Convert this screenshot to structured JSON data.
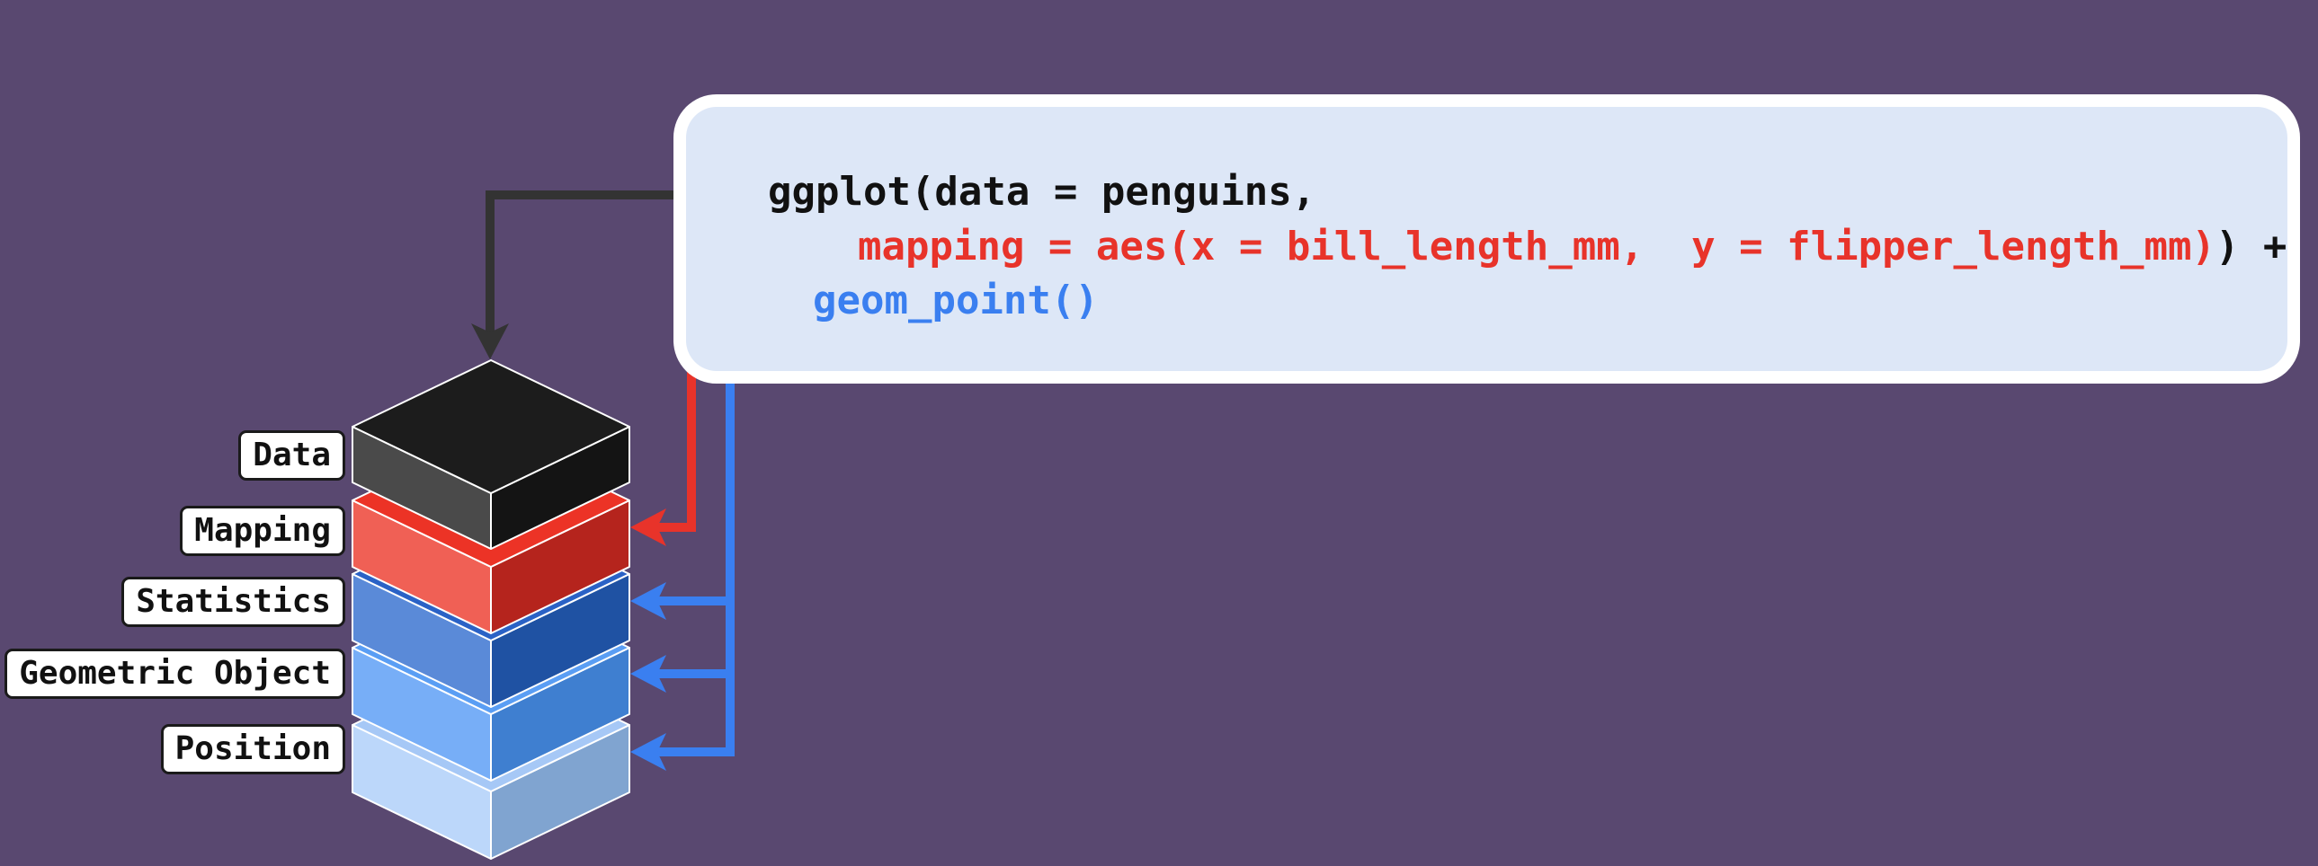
{
  "code": {
    "line1": "ggplot(data = penguins,",
    "line2_mapping": "mapping = aes(x = bill_length_mm,  y = flipper_length_mm)",
    "line2_tail": ") +",
    "line3": "geom_point()"
  },
  "layers": [
    {
      "label": "Data",
      "colors": {
        "top": "#1c1c1c",
        "left": "#4a4a4a",
        "right": "#141414"
      }
    },
    {
      "label": "Mapping",
      "colors": {
        "top": "#ec3326",
        "left": "#f06055",
        "right": "#b5241d"
      }
    },
    {
      "label": "Statistics",
      "colors": {
        "top": "#2a62c6",
        "left": "#5a8ad8",
        "right": "#1f52a3"
      }
    },
    {
      "label": "Geometric Object",
      "colors": {
        "top": "#5a9ef4",
        "left": "#77aef7",
        "right": "#3f7fd0"
      }
    },
    {
      "label": "Position",
      "colors": {
        "top": "#a6c8f6",
        "left": "#bcd7fa",
        "right": "#80a4d0"
      }
    }
  ],
  "colors": {
    "background": "#594870",
    "code_box": "#dde7f7",
    "arrow_data": "#333333",
    "arrow_mapping": "#e8332a",
    "arrow_geom": "#3a7ff0"
  }
}
